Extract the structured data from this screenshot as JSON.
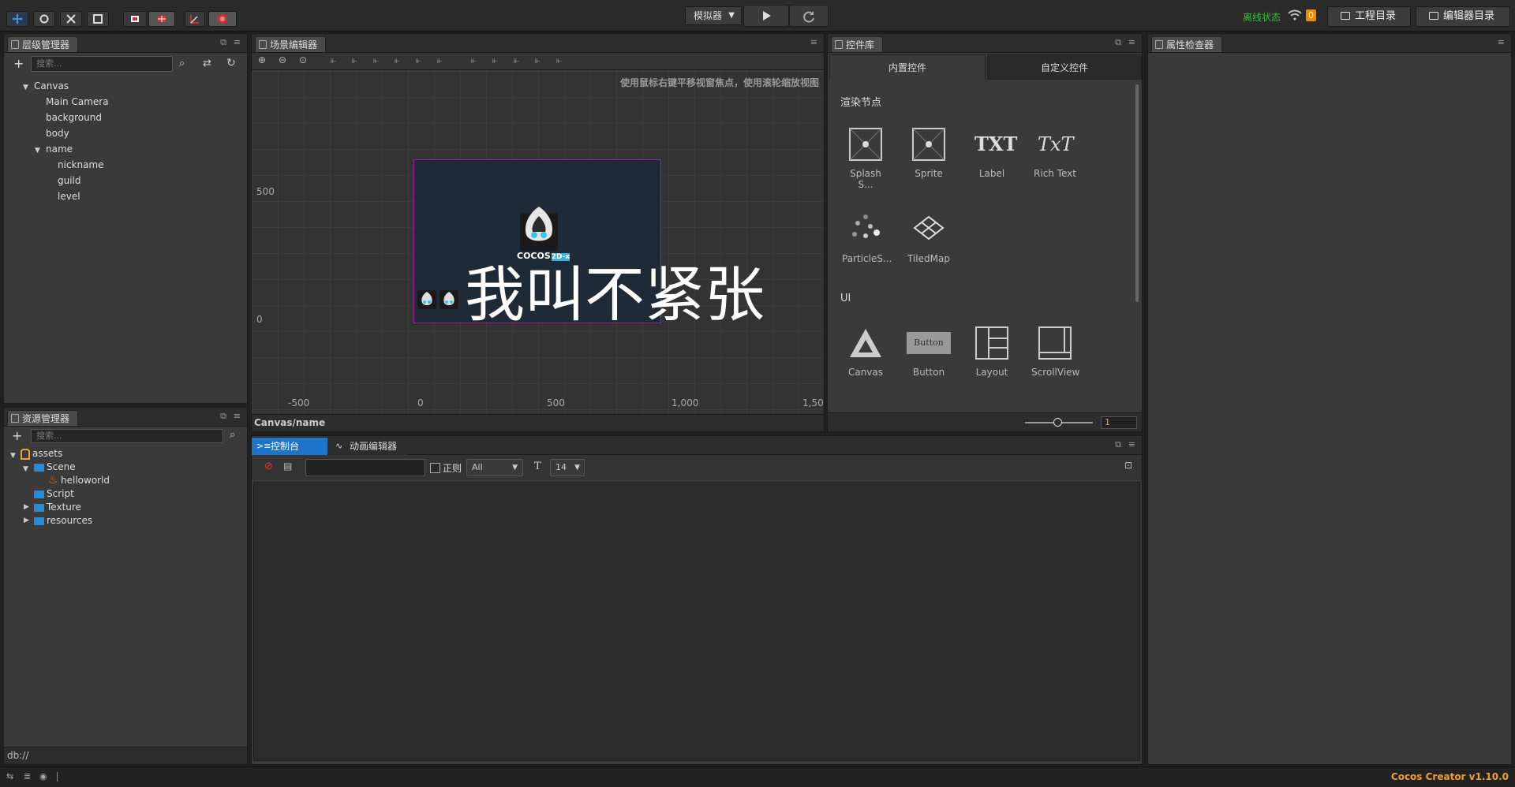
{
  "topbar": {
    "simulator_label": "模拟器",
    "status_text": "离线状态",
    "notification_count": "0",
    "project_dir_label": "工程目录",
    "editor_dir_label": "编辑器目录"
  },
  "hierarchy": {
    "tab_label": "层级管理器",
    "search_placeholder": "搜索...",
    "nodes": [
      "Canvas",
      "Main Camera",
      "background",
      "body",
      "name",
      "nickname",
      "guild",
      "level"
    ]
  },
  "scene": {
    "tab_label": "场景编辑器",
    "hint": "使用鼠标右键平移视窗焦点，使用滚轮缩放视图",
    "y_labels": [
      "500",
      "0"
    ],
    "x_labels": [
      "-500",
      "0",
      "500",
      "1,000",
      "1,50"
    ],
    "overlay_text": "我叫不紧张",
    "logo_text": "COCOS",
    "logo_suffix": "2D-x",
    "breadcrumb": "Canvas/name"
  },
  "widgets": {
    "tab_label": "控件库",
    "subtab_builtin": "内置控件",
    "subtab_custom": "自定义控件",
    "section_render": "渲染节点",
    "section_ui": "UI",
    "render_items": [
      "Splash S...",
      "Sprite",
      "Label",
      "Rich Text",
      "ParticleS...",
      "TiledMap"
    ],
    "ui_items": [
      "Canvas",
      "Button",
      "Layout",
      "ScrollView"
    ],
    "label_glyph": "TXT",
    "richtext_glyph": "TxT",
    "button_glyph": "Button",
    "zoom_value": "1"
  },
  "inspector": {
    "tab_label": "属性检查器"
  },
  "assets": {
    "tab_label": "资源管理器",
    "search_placeholder": "搜索...",
    "items": [
      "assets",
      "Scene",
      "helloworld",
      "Script",
      "Texture",
      "resources"
    ],
    "footer_path": "db://"
  },
  "console": {
    "tab_label": "控制台",
    "anim_tab_label": "动画编辑器",
    "regex_label": "正则",
    "filter_value": "All",
    "font_size_value": "14"
  },
  "statusbar": {
    "app_version": "Cocos Creator v1.10.0"
  },
  "colors": {
    "accent_blue": "#2a7fd4",
    "online_green": "#3cbf3c",
    "version_orange": "#f0a030",
    "badge_orange": "#f08a00"
  }
}
